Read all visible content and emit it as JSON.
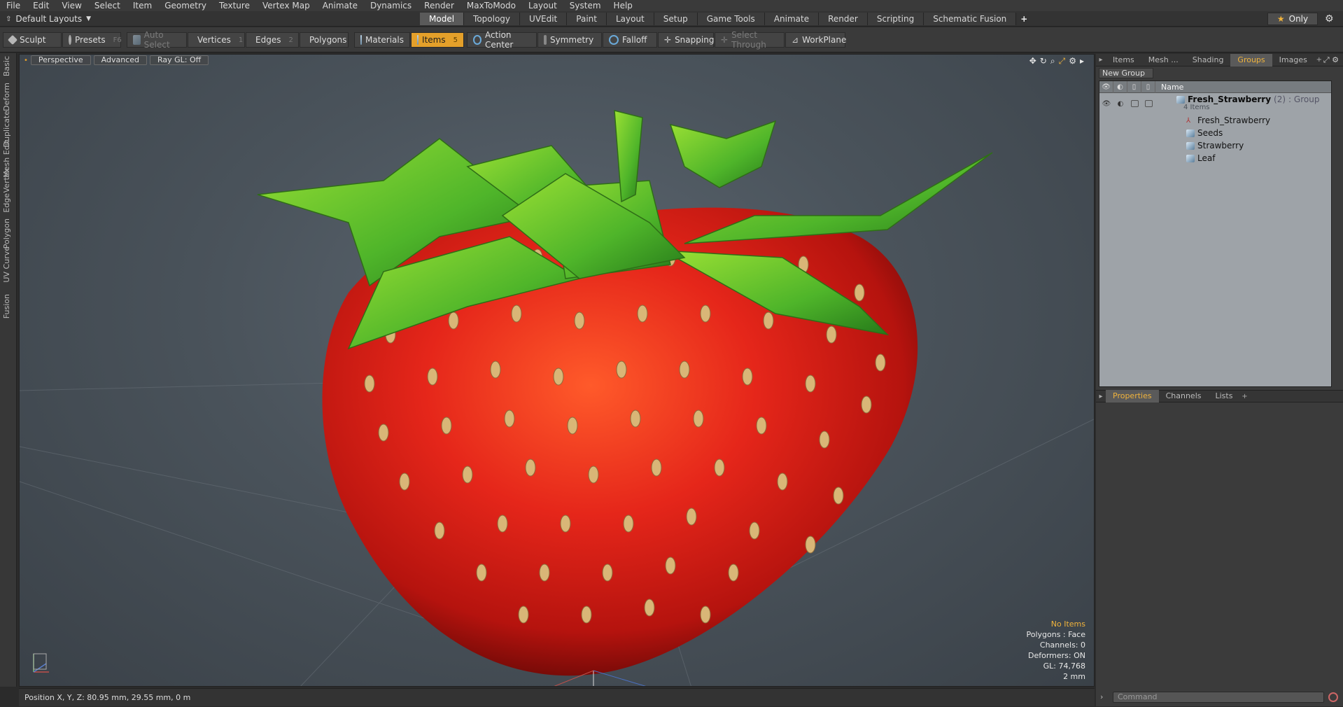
{
  "menu": [
    "File",
    "Edit",
    "View",
    "Select",
    "Item",
    "Geometry",
    "Texture",
    "Vertex Map",
    "Animate",
    "Dynamics",
    "Render",
    "MaxToModo",
    "Layout",
    "System",
    "Help"
  ],
  "layout_dropdown": "Default Layouts",
  "tabs": [
    "Model",
    "Topology",
    "UVEdit",
    "Paint",
    "Layout",
    "Setup",
    "Game Tools",
    "Animate",
    "Render",
    "Scripting",
    "Schematic Fusion"
  ],
  "active_tab": "Model",
  "only_label": "Only",
  "toolbar": {
    "sculpt": "Sculpt",
    "presets": "Presets",
    "presets_key": "F6",
    "auto_select": "Auto Select",
    "vertices": "Vertices",
    "vertices_key": "1",
    "edges": "Edges",
    "edges_key": "2",
    "polygons": "Polygons",
    "materials": "Materials",
    "items": "Items",
    "items_key": "5",
    "action_center": "Action Center",
    "symmetry": "Symmetry",
    "falloff": "Falloff",
    "snapping": "Snapping",
    "select_through": "Select Through",
    "workplane": "WorkPlane"
  },
  "side_tabs": [
    "Basic",
    "Deform",
    "Duplicate",
    "Mesh Edit",
    "Vertex",
    "Edge",
    "Polygon",
    "Curve",
    "UV",
    "Fusion"
  ],
  "viewport": {
    "view": "Perspective",
    "shading": "Advanced",
    "raygl": "Ray GL: Off",
    "stats": {
      "items": "No Items",
      "polygons": "Polygons : Face",
      "channels": "Channels: 0",
      "deformers": "Deformers: ON",
      "gl": "GL: 74,768",
      "unit": "2 mm"
    }
  },
  "status": {
    "position": "Position X, Y, Z:  80.95 mm, 29.55 mm, 0 m"
  },
  "right_tabs": [
    "Items",
    "Mesh ...",
    "Shading",
    "Groups",
    "Images"
  ],
  "active_right_tab": "Groups",
  "new_group": "New Group",
  "groups": {
    "header_name": "Name",
    "group": {
      "name": "Fresh_Strawberry",
      "count": "(2)",
      "type": ": Group",
      "sub": "4 Items"
    },
    "children": [
      "Fresh_Strawberry",
      "Seeds",
      "Strawberry",
      "Leaf"
    ]
  },
  "props_tabs": [
    "Properties",
    "Channels",
    "Lists"
  ],
  "command_placeholder": "Command",
  "colors": {
    "accent": "#e4a02a",
    "strawberry": "#d8261a",
    "leaf": "#5cc22a"
  }
}
